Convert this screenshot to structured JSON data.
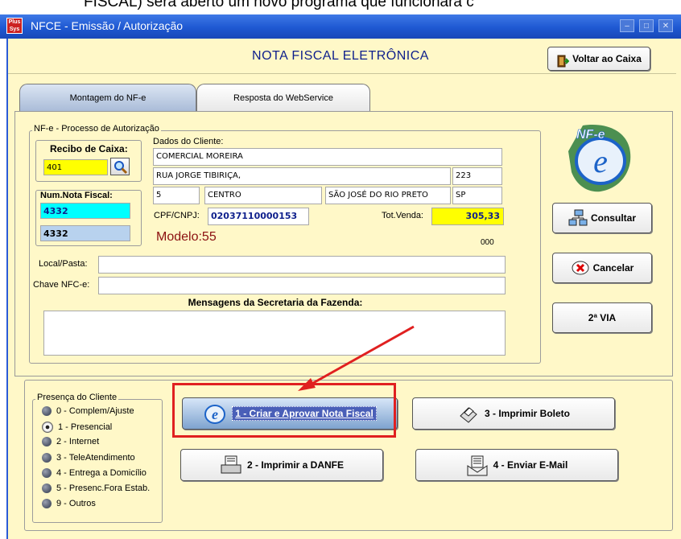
{
  "doc_fragment": "FISCAL) será aberto um novo programa que funcionará c",
  "window": {
    "title": "NFCE - Emissão / Autorização",
    "app_icon_text": "Plus Sys",
    "controls": [
      "–",
      "□",
      "✕"
    ]
  },
  "header": {
    "title": "NOTA FISCAL ELETRÔNICA",
    "voltar_label": "Voltar ao Caixa"
  },
  "tabs": [
    {
      "label": "Montagem do NF-e",
      "active": true
    },
    {
      "label": "Resposta do WebService",
      "active": false
    }
  ],
  "process_group": {
    "title": "NF-e - Processo de Autorização",
    "recibo_label": "Recibo de Caixa:",
    "recibo_value": "401",
    "num_nota_label": "Num.Nota Fiscal:",
    "num_nota_value1": "4332",
    "num_nota_value2": "4332",
    "dados_cliente_label": "Dados do Cliente:",
    "cliente_nome": "COMERCIAL MOREIRA",
    "endereco": "RUA JORGE TIBIRIÇA,",
    "numero": "223",
    "campo_5": "5",
    "bairro": "CENTRO",
    "cidade": "SÃO JOSÉ DO RIO PRETO",
    "uf": "SP",
    "cpf_label": "CPF/CNPJ:",
    "cpf_value": "02037110000153",
    "tot_venda_label": "Tot.Venda:",
    "tot_venda_value": "305,33",
    "modelo": "Modelo:55",
    "serie": "000",
    "local_label": "Local/Pasta:",
    "chave_label": "Chave NFC-e:",
    "mensagens_label": "Mensagens da Secretaria da Fazenda:",
    "logo_text": "NF-e"
  },
  "side_buttons": {
    "consultar": "Consultar",
    "cancelar": "Cancelar",
    "segunda_via": "2ª VIA"
  },
  "presenca": {
    "title": "Presença do Cliente",
    "options": [
      "0 - Complem/Ajuste",
      "1 - Presencial",
      "2 - Internet",
      "3 - TeleAtendimento",
      "4 - Entrega a Domicílio",
      "5 - Presenc.Fora Estab.",
      "9 - Outros"
    ],
    "selected_index": 1
  },
  "actions": {
    "criar": "1 - Criar e Aprovar Nota Fiscal",
    "imprimir_danfe": "2 - Imprimir a DANFE",
    "imprimir_boleto": "3 - Imprimir Boleto",
    "enviar_email": "4 - Enviar E-Mail"
  },
  "colors": {
    "window_bg": "#fff8c8",
    "titlebar": "#1e58d2",
    "highlight_box": "#e02020",
    "recibo_bg": "#ffff00",
    "nota_bg": "#00ffff",
    "modelo_text": "#8b1010"
  }
}
